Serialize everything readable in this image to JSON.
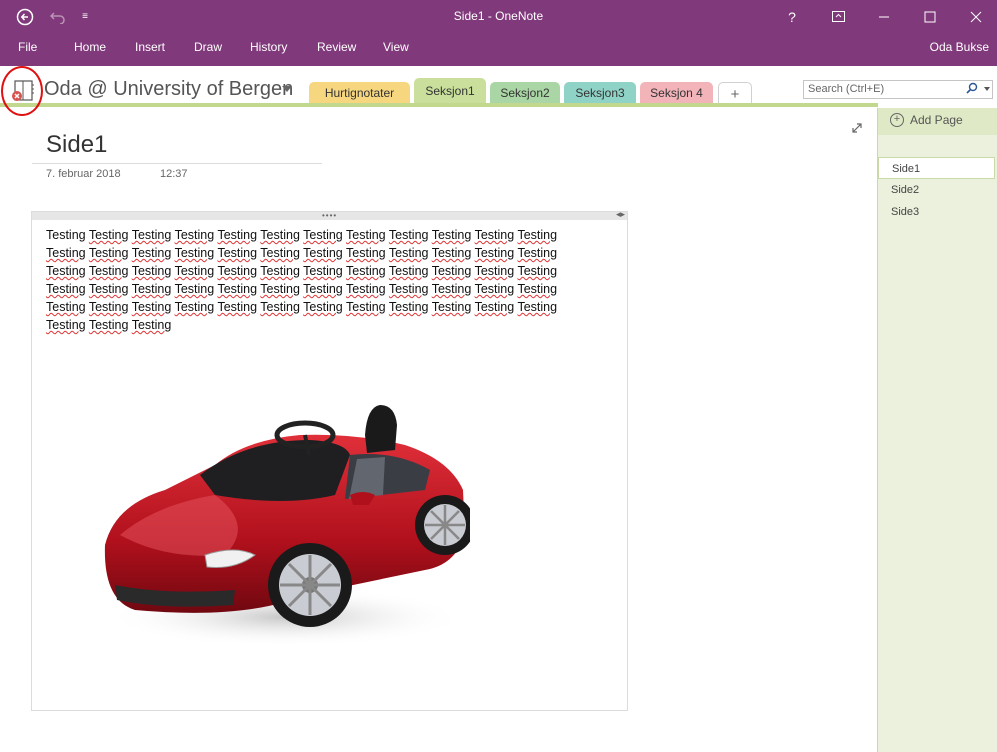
{
  "window": {
    "title": "Side1 - OneNote"
  },
  "titlebar": {
    "help": "?"
  },
  "ribbon": {
    "tabs": [
      "File",
      "Home",
      "Insert",
      "Draw",
      "History",
      "Review",
      "View"
    ],
    "user": "Oda Bukse"
  },
  "notebook": {
    "name": "Oda @ University of Bergen"
  },
  "sections": [
    {
      "label": "Hurtignotater",
      "color": "#f7d680"
    },
    {
      "label": "Seksjon1",
      "color": "#c9df9b"
    },
    {
      "label": "Seksjon2",
      "color": "#a9d6a4"
    },
    {
      "label": "Seksjon3",
      "color": "#8fd2c6"
    },
    {
      "label": "Seksjon 4",
      "color": "#f2b3b9"
    }
  ],
  "add_section": "+",
  "search": {
    "placeholder": "Search (Ctrl+E)"
  },
  "page": {
    "title": "Side1",
    "date": "7. februar 2018",
    "time": "12:37",
    "word": "Testing",
    "word_count": 63,
    "words_per_line": 12
  },
  "pagepane": {
    "add_page": "Add Page",
    "pages": [
      "Side1",
      "Side2",
      "Side3"
    ]
  },
  "colors": {
    "accent": "#80397b",
    "section_green": "#c1d88e",
    "pane": "#ebf1dd"
  },
  "icons": [
    "back-icon",
    "undo-icon",
    "quick-access-icon",
    "help-icon",
    "ribbon-display-icon",
    "minimize-icon",
    "maximize-icon",
    "close-icon",
    "notebook-sync-error-icon",
    "search-icon",
    "expand-icon",
    "add-page-icon"
  ]
}
